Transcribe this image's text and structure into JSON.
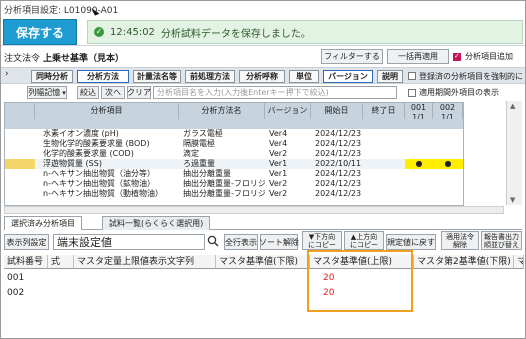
{
  "header": {
    "breadcrumb": "分析項目設定: L01090-A01",
    "save_label": "保存する",
    "toast_time": "12:45:02",
    "toast_message": "分析試料データを保存しました。"
  },
  "order_bar": {
    "label": "注文法令",
    "value": "上乗せ基準（見本）",
    "filter_label": "フィルターする",
    "bulk_apply_label": "一括再適用",
    "add_items_label": "分析項目追加",
    "add_items_checked": true
  },
  "column_tabs": [
    "同時分析",
    "分析方法",
    "計量法名等",
    "前処理方法",
    "分析呼称",
    "単位",
    "バージョン",
    "説明"
  ],
  "column_tabs_active": [
    1,
    6
  ],
  "options": {
    "force_register_label": "登録済の分析項目を強制的に",
    "exclude_period_label": "適用期間外項目の表示",
    "force_register_checked": false,
    "exclude_period_checked": false
  },
  "filter_row": {
    "column_settings": "列幅記憶",
    "narrow": "絞込",
    "next": "次へ",
    "clear": "クリア",
    "placeholder": "分析項目名を入力(入力後Enterキー押下で絞込)"
  },
  "item_grid": {
    "headers": [
      "分析項目",
      "分析方法名",
      "バージョン",
      "開始日",
      "終了日",
      "001",
      "002"
    ],
    "sub_headers": [
      "",
      "",
      "",
      "",
      "",
      "1/1",
      "1/1"
    ],
    "rows": [
      {
        "name": "",
        "method": "",
        "version": "",
        "start": "",
        "end": "",
        "c1": "",
        "c2": ""
      },
      {
        "name": "水素イオン濃度 (pH)",
        "method": "ガラス電極",
        "version": "Ver4",
        "start": "2024/12/23",
        "end": "",
        "c1": "",
        "c2": ""
      },
      {
        "name": "生物化学的酸素要求量 (BOD)",
        "method": "隔膜電極",
        "version": "Ver4",
        "start": "2024/12/23",
        "end": "",
        "c1": "",
        "c2": ""
      },
      {
        "name": "化学的酸素要求量 (COD)",
        "method": "滴定",
        "version": "Ver2",
        "start": "2024/12/23",
        "end": "",
        "c1": "",
        "c2": ""
      },
      {
        "name": "浮遊物質量 (SS)",
        "method": "ろ過重量",
        "version": "Ver1",
        "start": "2022/10/11",
        "end": "",
        "c1": "●",
        "c2": "●"
      },
      {
        "name": "n-ヘキサン抽出物質（油分等）",
        "method": "抽出分離重量",
        "version": "Ver1",
        "start": "2024/12/23",
        "end": "",
        "c1": "",
        "c2": ""
      },
      {
        "name": "n-ヘキサン抽出物質（鉱物油）",
        "method": "抽出分離重量-フロリジル",
        "version": "Ver2",
        "start": "2024/12/23",
        "end": "",
        "c1": "",
        "c2": ""
      },
      {
        "name": "n-ヘキサン抽出物質（動植物油）",
        "method": "抽出分離重量-フロリジル",
        "version": "Ver2",
        "start": "2024/12/23",
        "end": "",
        "c1": "",
        "c2": ""
      }
    ]
  },
  "lower_tabs": [
    "選択済み分析項目",
    "試料一覧(らくらく選択用)"
  ],
  "lower_toolbar": {
    "display_settings": "表示列設定",
    "search_value": "端末設定値",
    "show_all": "全行表示",
    "sort_clear": "ソート解除",
    "move_down": "▼下方向\nにコピー",
    "move_up": "▲上方向\nにコピー",
    "reset_default": "規定値に戻す",
    "apply_law": "適用法令\n解除",
    "report_output": "報告書出力\n順並び替え"
  },
  "sample_grid": {
    "headers": [
      "試料番号",
      "式",
      "マスタ定量上限値表示文字列",
      "マスタ基準値(下限)",
      "マスタ基準値(上限)",
      "マスタ第2基準値(下限)",
      "マ"
    ],
    "rows": [
      {
        "id": "001",
        "formula": "",
        "upper_display": "",
        "lower": "",
        "upper": "20",
        "second_lower": ""
      },
      {
        "id": "002",
        "formula": "",
        "upper_display": "",
        "lower": "",
        "upper": "20",
        "second_lower": ""
      }
    ]
  },
  "colors": {
    "primary": "#1e9bd0",
    "success_bg": "#e3f3e3",
    "highlight": "#f0a020",
    "marker_yellow": "#ffee00",
    "error_red": "#e02020"
  }
}
